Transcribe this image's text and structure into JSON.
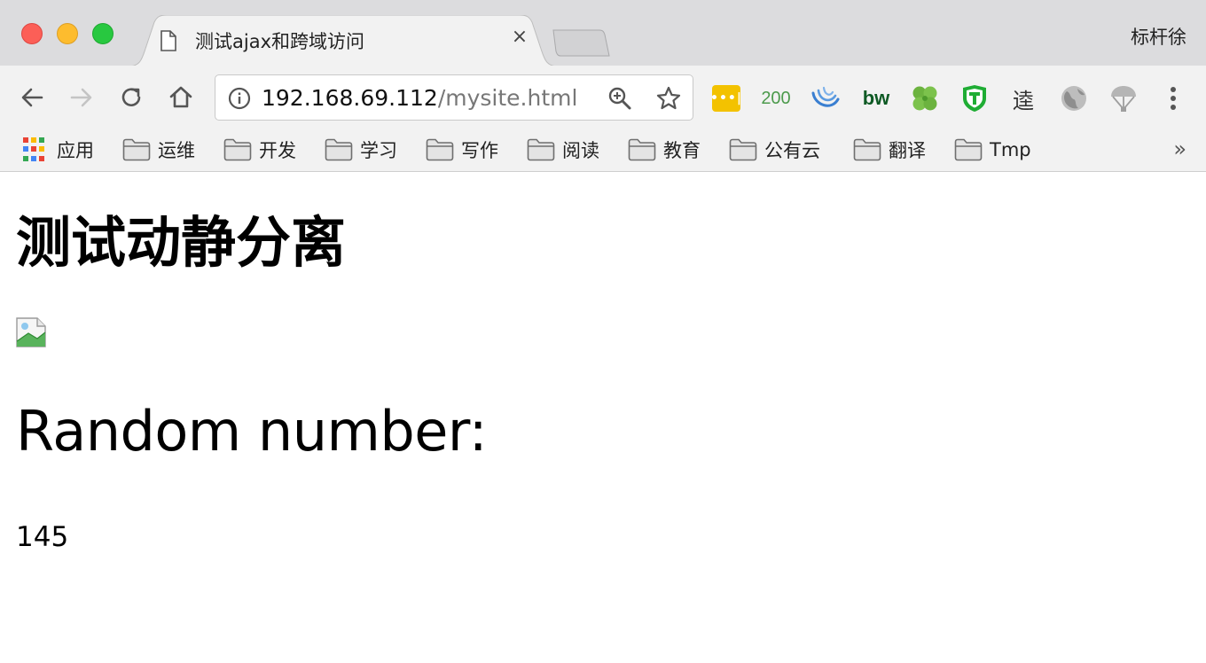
{
  "window": {
    "tab_title": "测试ajax和跨域访问",
    "tab_close": "×",
    "profile_name": "标杆徐"
  },
  "toolbar": {
    "url_host": "192.168.69.112",
    "url_path": "/mysite.html",
    "extensions": [
      {
        "name": "lastpass",
        "label": "•••|",
        "color": "#f3c200"
      },
      {
        "name": "http-status-200",
        "label": "200",
        "color": "#4c9a4c"
      },
      {
        "name": "wave-extension",
        "color": "#3a7fd1"
      },
      {
        "name": "bw-extension",
        "label": "bw",
        "color": "#0e5a24"
      },
      {
        "name": "clover-extension",
        "color": "#6cb33f"
      },
      {
        "name": "shield-t-extension",
        "label": "T",
        "color": "#1fad34"
      },
      {
        "name": "yuan-extension",
        "label": "逵"
      },
      {
        "name": "globe-extension",
        "color": "#9e9e9e"
      },
      {
        "name": "parachute-extension",
        "color": "#9e9e9e"
      }
    ]
  },
  "bookmarks": {
    "apps_label": "应用",
    "folders": [
      "运维",
      "开发",
      "学习",
      "写作",
      "阅读",
      "教育",
      "公有云",
      "翻译",
      "Tmp"
    ],
    "more": "»",
    "apps_colors": [
      "#e94335",
      "#fbbc05",
      "#34a853",
      "#4285f4",
      "#ea4335",
      "#fbbc05",
      "#34a853",
      "#4285f4",
      "#ea4335"
    ]
  },
  "page": {
    "heading": "测试动静分离",
    "subheading": "Random number:",
    "number": "145"
  }
}
